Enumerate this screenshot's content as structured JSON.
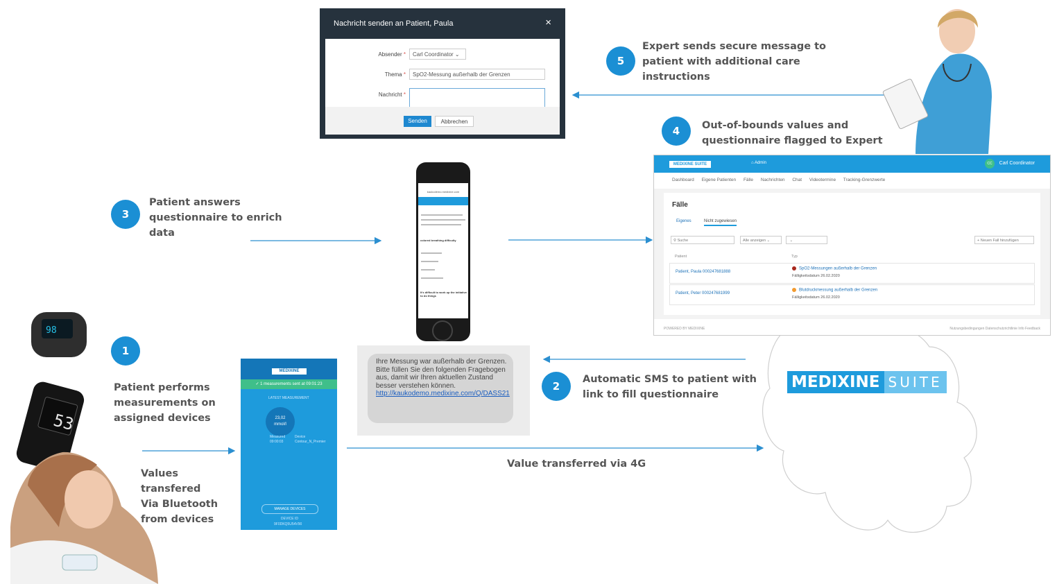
{
  "steps": {
    "s1": {
      "num": "1",
      "lines": [
        "Patient performs",
        "measurements on",
        "assigned devices"
      ]
    },
    "s1b": {
      "lines": [
        "Values",
        "transfered",
        "Via Bluetooth",
        "from devices"
      ]
    },
    "s2": {
      "num": "2",
      "lines": [
        "Automatic SMS to patient with",
        "link to fill questionnaire"
      ]
    },
    "s3": {
      "num": "3",
      "lines": [
        "Patient answers",
        "questionnaire to enrich",
        "data"
      ]
    },
    "s4": {
      "num": "4",
      "lines": [
        "Out-of-bounds values and",
        "questionnaire flagged to Expert"
      ]
    },
    "s5": {
      "num": "5",
      "lines": [
        "Expert sends secure message to",
        "patient with additional care",
        "instructions"
      ]
    },
    "g4": "Value transferred via 4G"
  },
  "dialog": {
    "title": "Nachricht senden an Patient, Paula",
    "close": "×",
    "sender_label": "Absender",
    "sender_value": "Carl Coordinator",
    "topic_label": "Thema",
    "topic_value": "SpO2-Messung außerhalb der Grenzen",
    "message_label": "Nachricht",
    "message_value": "",
    "required": "*",
    "send": "Senden",
    "cancel": "Abbrechen"
  },
  "sms": {
    "text": "Ihre Messung war außerhalb der Grenzen. Bitte füllen Sie den folgenden Fragebogen aus, damit wir Ihren aktuellen Zustand besser verstehen können.",
    "link": "http://kaukodemo.medixine.com/Q/DASS21"
  },
  "phone1": {
    "logo": "MEDIXINE",
    "status": "✓ 1 measurements sent at 09:01:23",
    "section": "LATEST MEASUREMENT",
    "value": "23,02",
    "unit": "mmol/l",
    "measured_label": "Measured",
    "measured_value": "09:00:03",
    "device_label": "Device",
    "device_value": "Contour_N_Premier",
    "manage": "MANAGE DEVICES",
    "device_id_label": "DEVICE ID",
    "device_id": "9F0DKQ5U54V90"
  },
  "phone2": {
    "url": "kaukodemo.medixine.com",
    "q1": "colored breathing difficulty",
    "q2": "It's difficult to work up the initiative to do things"
  },
  "dashboard": {
    "logo": "MEDIXINE SUITE",
    "admin": "Admin",
    "avatar": "CC",
    "user": "Carl Coordinator",
    "nav": [
      "Dashboard",
      "Eigene Patienten",
      "Fälle",
      "Nachrichten",
      "Chat",
      "Videotermine",
      "Tracking-Grenzwerte"
    ],
    "heading": "Fälle",
    "tab1": "Eigenes",
    "tab2": "Nicht zugewiesen",
    "search": "Suche",
    "filter": "Alle anzeigen",
    "add": "+ Neuen Fall hinzufügen",
    "col1": "Patient",
    "col2": "Typ",
    "rows": [
      {
        "patient": "Patient, Paula  000247681888",
        "case": "SpO2-Messungen außerhalb der Grenzen",
        "due": "Fälligkeitsdatum 26.02.2020",
        "color": "#a8281d"
      },
      {
        "patient": "Patient, Peter  000247681999",
        "case": "Blutdruckmessung außerhalb der Grenzen",
        "due": "Fälligkeitsdatum 26.02.2020",
        "color": "#f29a2e"
      }
    ],
    "footer_left": "POWERED BY MEDIXINE",
    "footer_right": "Nutzungsbedingungen  Datenschutzrichtlinie  Info  Feedback"
  },
  "medixine_logo": {
    "a": "MEDIXINE",
    "b": "SUITE"
  },
  "colors": {
    "accent": "#1b8fd4",
    "line": "#2b8fd0"
  }
}
